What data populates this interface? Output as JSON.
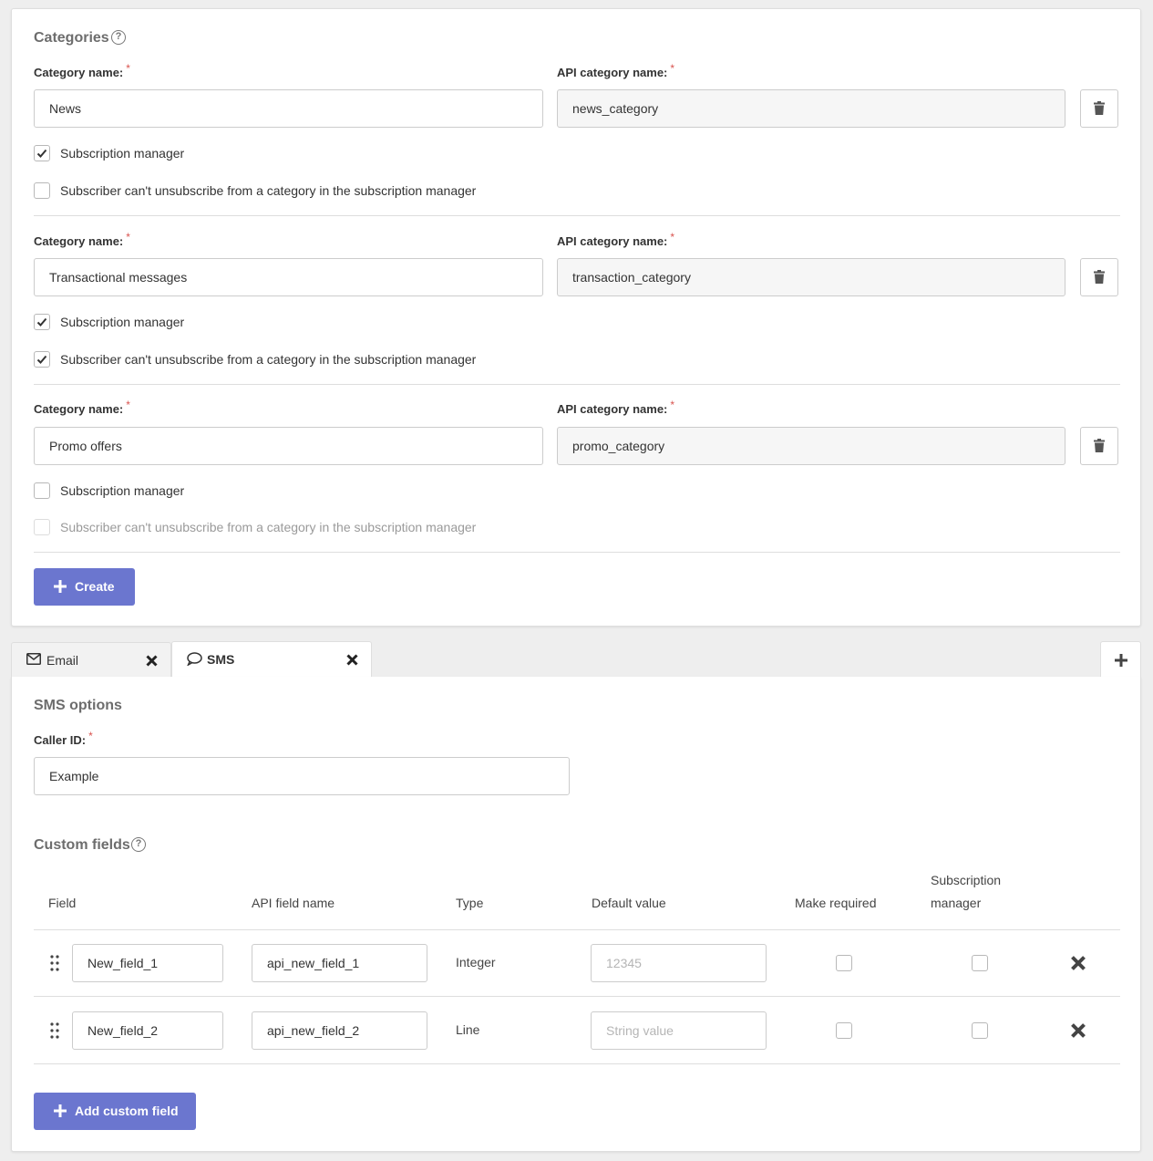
{
  "categories": {
    "title": "Categories",
    "help": "?",
    "name_label": "Category name:",
    "api_label": "API category name:",
    "required_mark": "*",
    "subscription_manager_label": "Subscription manager",
    "cant_unsubscribe_label": "Subscriber can't unsubscribe from a category in the subscription manager",
    "items": [
      {
        "name": "News",
        "api_name": "news_category",
        "subscription_manager": true,
        "cant_unsubscribe": false,
        "cant_unsubscribe_disabled": false
      },
      {
        "name": "Transactional messages",
        "api_name": "transaction_category",
        "subscription_manager": true,
        "cant_unsubscribe": true,
        "cant_unsubscribe_disabled": false
      },
      {
        "name": "Promo offers",
        "api_name": "promo_category",
        "subscription_manager": false,
        "cant_unsubscribe": false,
        "cant_unsubscribe_disabled": true
      }
    ],
    "create_label": "Create"
  },
  "tabs": [
    {
      "label": "Email",
      "icon": "envelope-icon",
      "active": false
    },
    {
      "label": "SMS",
      "icon": "speech-bubble-icon",
      "active": true
    }
  ],
  "sms": {
    "title": "SMS options",
    "caller_id_label": "Caller ID:",
    "caller_id_value": "Example"
  },
  "custom_fields": {
    "title": "Custom fields",
    "help": "?",
    "headers": {
      "field": "Field",
      "api_field_name": "API field name",
      "type": "Type",
      "default_value": "Default value",
      "make_required": "Make required",
      "subscription_manager_line1": "Subscription",
      "subscription_manager_line2": "manager"
    },
    "rows": [
      {
        "field": "New_field_1",
        "api_name": "api_new_field_1",
        "type": "Integer",
        "default_placeholder": "12345",
        "required": false,
        "subscription_manager": false
      },
      {
        "field": "New_field_2",
        "api_name": "api_new_field_2",
        "type": "Line",
        "default_placeholder": "String value",
        "required": false,
        "subscription_manager": false
      }
    ],
    "add_label": "Add custom field"
  },
  "colors": {
    "primary": "#6b76cf",
    "required": "#d9534f",
    "border": "#cccccc"
  }
}
